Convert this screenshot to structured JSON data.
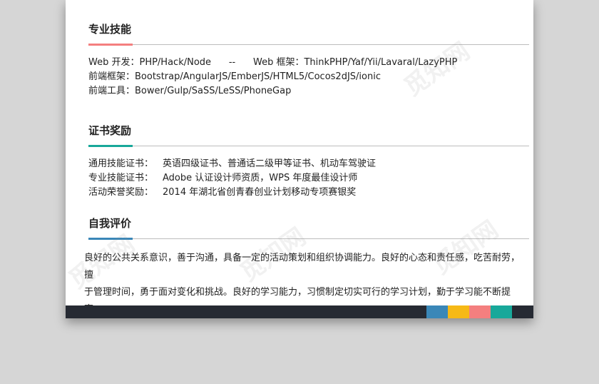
{
  "colors": {
    "skills_accent": "#f47f7f",
    "cert_accent": "#18a89a",
    "eval_accent": "#3a87b8",
    "footer_bg": "#262a33",
    "footer_swatches": [
      "#3a87b8",
      "#f6b916",
      "#f47f7f",
      "#18a89a"
    ]
  },
  "skills": {
    "title": "专业技能",
    "rows": [
      "Web 开发：PHP/Hack/Node      --      Web 框架：ThinkPHP/Yaf/Yii/Lavaral/LazyPHP",
      "前端框架：Bootstrap/AngularJS/EmberJS/HTML5/Cocos2dJS/ionic",
      "前端工具：Bower/Gulp/SaSS/LeSS/PhoneGap"
    ]
  },
  "certs": {
    "title": "证书奖励",
    "rows": [
      {
        "label": "通用技能证书：",
        "value": "英语四级证书、普通话二级甲等证书、机动车驾驶证"
      },
      {
        "label": "专业技能证书：",
        "value": "Adobe 认证设计师资质，WPS 年度最佳设计师"
      },
      {
        "label": "活动荣誉奖励：",
        "value": "2014 年湖北省创青春创业计划移动专项赛银奖"
      }
    ]
  },
  "evaluation": {
    "title": "自我评价",
    "lines": [
      "良好的公共关系意识，善于沟通，具备一定的活动策划和组织协调能力。良好的心态和责任感，吃苦耐劳，擅",
      "于管理时间，勇于面对变化和挑战。良好的学习能力，习惯制定切实可行的学习计划，勤于学习能不断提高。"
    ]
  },
  "watermark_text": "觅知网"
}
